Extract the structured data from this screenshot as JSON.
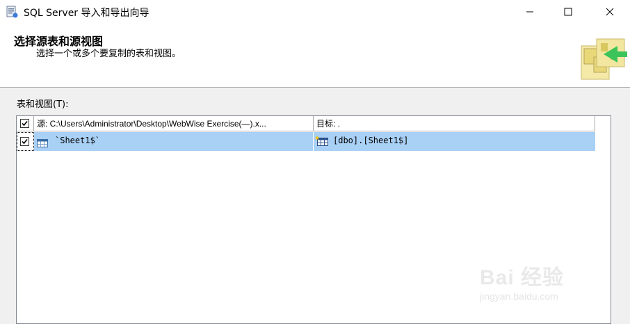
{
  "window": {
    "title": "SQL Server 导入和导出向导",
    "app_icon": "wizard-icon",
    "controls": [
      "minimize-icon",
      "maximize-icon",
      "close-icon"
    ]
  },
  "header": {
    "title": "选择源表和源视图",
    "subtitle": "选择一个或多个要复制的表和视图。",
    "art": "folder-arrow-graphic"
  },
  "tables_section": {
    "label": "表和视图(T):",
    "columns": {
      "source": "源: C:\\Users\\Administrator\\Desktop\\WebWise Exercise(—).x...",
      "destination": "目标: ."
    },
    "header_checked": true,
    "rows": [
      {
        "checked": true,
        "source": "`Sheet1$`",
        "destination": "[dbo].[Sheet1$]",
        "selected": true
      }
    ]
  },
  "watermark": {
    "brand": "Bai 经验",
    "url": "jingyan.baidu.com"
  },
  "colors": {
    "selection": "#a9d0f5",
    "header_bg": "#ffffff",
    "body_bg": "#f0f0f0"
  }
}
